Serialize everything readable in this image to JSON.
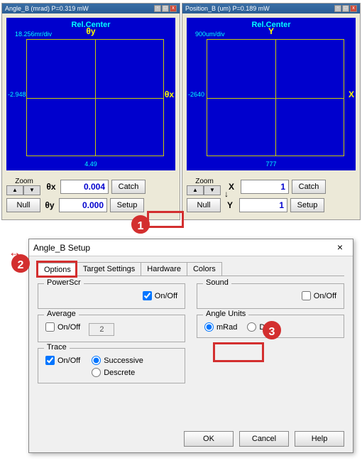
{
  "windows": {
    "left": {
      "title": "Angle_B (mrad)   P=0.319 mW",
      "rel_center": "Rel.Center",
      "div_text": "18.256mr/div",
      "axis_top": "θy",
      "axis_right": "θx",
      "axis_left_val": "-2.948",
      "axis_bot_val": "4.49",
      "zoom_label": "Zoom",
      "fields": {
        "x_label": "θx",
        "x_value": "0.004",
        "y_label": "θy",
        "y_value": "0.000"
      },
      "buttons": {
        "catch": "Catch",
        "setup": "Setup",
        "null": "Null"
      }
    },
    "right": {
      "title": "Position_B (um)   P=0.189 mW",
      "rel_center": "Rel.Center",
      "div_text": "900um/div",
      "axis_top": "Y",
      "axis_right": "X",
      "axis_left_val": "-2640",
      "axis_bot_val": "777",
      "zoom_label": "Zoom",
      "fields": {
        "x_label": "X",
        "x_value": "1",
        "y_label": "Y",
        "y_value": "1"
      },
      "buttons": {
        "catch": "Catch",
        "setup": "Setup",
        "null": "Null"
      }
    }
  },
  "dialog": {
    "title": "Angle_B Setup",
    "tabs": [
      "Options",
      "Target Settings",
      "Hardware",
      "Colors"
    ],
    "active_tab": 0,
    "groups": {
      "powerscr": {
        "title": "PowerScr",
        "onoff_label": "On/Off",
        "checked": true
      },
      "sound": {
        "title": "Sound",
        "onoff_label": "On/Off",
        "checked": false
      },
      "average": {
        "title": "Average",
        "onoff_label": "On/Off",
        "checked": false,
        "spin_value": "2"
      },
      "angle_units": {
        "title": "Angle Units",
        "options": [
          "mRad",
          "Deg"
        ],
        "selected": "mRad"
      },
      "trace": {
        "title": "Trace",
        "onoff_label": "On/Off",
        "checked": true,
        "modes": [
          "Successive",
          "Descrete"
        ],
        "selected_mode": "Successive"
      }
    },
    "buttons": {
      "ok": "OK",
      "cancel": "Cancel",
      "help": "Help"
    }
  },
  "annotations": {
    "one": "1",
    "two": "2",
    "three": "3"
  }
}
